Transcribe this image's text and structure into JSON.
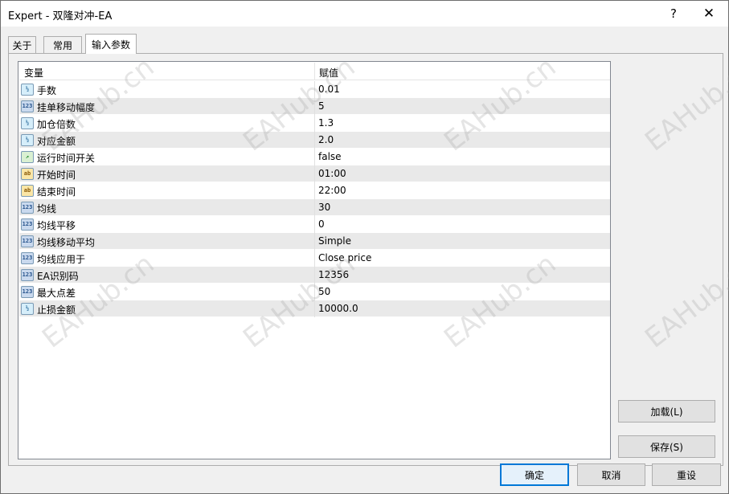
{
  "window": {
    "title": "Expert - 双隆对冲-EA",
    "help_label": "?",
    "close_label": "✕"
  },
  "tabs": [
    {
      "label": "关于"
    },
    {
      "label": "常用"
    },
    {
      "label": "输入参数"
    }
  ],
  "grid": {
    "headers": {
      "variable": "变量",
      "value": "赋值"
    },
    "rows": [
      {
        "icon": "fraction-icon",
        "label": "手数",
        "value": "0.01"
      },
      {
        "icon": "integer-icon",
        "label": "挂单移动幅度",
        "value": "5"
      },
      {
        "icon": "fraction-icon",
        "label": "加仓倍数",
        "value": "1.3"
      },
      {
        "icon": "fraction-icon",
        "label": "对应金额",
        "value": "2.0"
      },
      {
        "icon": "bool-icon",
        "label": "运行时间开关",
        "value": "false"
      },
      {
        "icon": "string-icon",
        "label": "开始时间",
        "value": "01:00"
      },
      {
        "icon": "string-icon",
        "label": "结束时间",
        "value": "22:00"
      },
      {
        "icon": "integer-icon",
        "label": "均线",
        "value": "30"
      },
      {
        "icon": "integer-icon",
        "label": "均线平移",
        "value": "0"
      },
      {
        "icon": "integer-icon",
        "label": "均线移动平均",
        "value": "Simple"
      },
      {
        "icon": "integer-icon",
        "label": "均线应用于",
        "value": "Close price"
      },
      {
        "icon": "integer-icon",
        "label": "EA识别码",
        "value": "12356"
      },
      {
        "icon": "integer-icon",
        "label": "最大点差",
        "value": "50"
      },
      {
        "icon": "fraction-icon",
        "label": "止损金额",
        "value": "10000.0"
      }
    ]
  },
  "icon_glyphs": {
    "fraction": "½",
    "integer": "123",
    "bool": "↗",
    "string": "ab"
  },
  "buttons": {
    "load": "加载(L)",
    "save": "保存(S)",
    "ok": "确定",
    "cancel": "取消",
    "reset": "重设"
  },
  "watermark": "EAHub.cn",
  "colors": {
    "accent": "#0078d7",
    "row_alt": "#e9e9e9"
  }
}
